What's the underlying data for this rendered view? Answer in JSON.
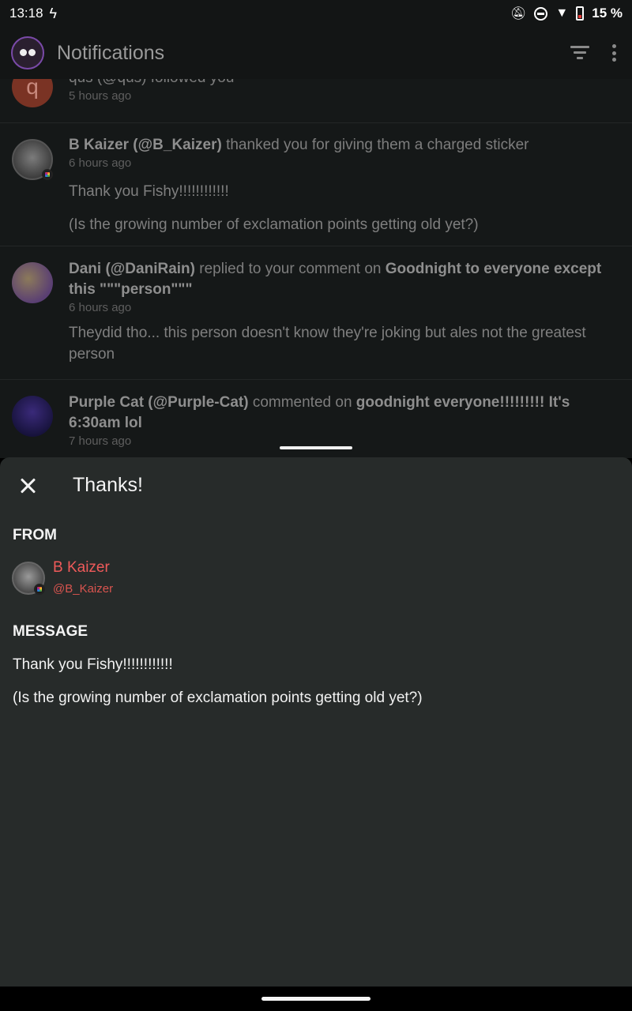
{
  "status_bar": {
    "time": "13:18",
    "battery_percent": "15 %"
  },
  "app_bar": {
    "title": "Notifications"
  },
  "notifications": [
    {
      "avatar_letter": "q",
      "text": "qus (@qus) followed you",
      "time": "5 hours ago"
    },
    {
      "user": "B Kaizer (@B_Kaizer)",
      "action": " thanked you for giving them a charged sticker",
      "time": "6 hours ago",
      "body_1": "Thank you Fishy!!!!!!!!!!!!",
      "body_2": "(Is the growing number of exclamation points getting old yet?)"
    },
    {
      "user": "Dani (@DaniRain)",
      "action": " replied to your comment on ",
      "target": "Goodnight to everyone except this \"\"\"person\"\"\"",
      "time": "6 hours ago",
      "body_1": "Theydid tho... this person doesn't know they're joking but ales not the greatest person"
    },
    {
      "user": "Purple Cat (@Purple-Cat)",
      "action": " commented on ",
      "target": "goodnight everyone!!!!!!!!! It's 6:30am lol",
      "time": "7 hours ago"
    }
  ],
  "sheet": {
    "title": "Thanks!",
    "from_label": "FROM",
    "from_name": "B Kaizer",
    "from_handle": "@B_Kaizer",
    "message_label": "MESSAGE",
    "message_1": "Thank you Fishy!!!!!!!!!!!!",
    "message_2": "(Is the growing number of exclamation points getting old yet?)"
  }
}
